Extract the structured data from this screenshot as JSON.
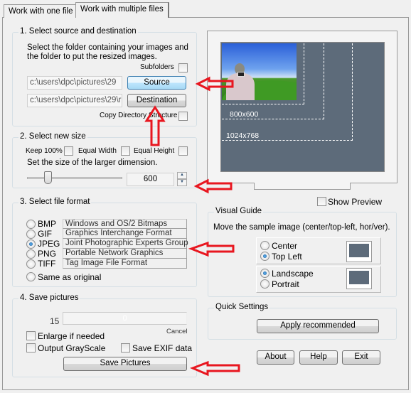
{
  "tabs": [
    {
      "label": "Work with one file"
    },
    {
      "label": "Work with multiple files",
      "active": true
    }
  ],
  "group1": {
    "title": "1. Select source and destination",
    "description_line1": "Select the folder containing your images and",
    "description_line2": "the folder to put the resized images.",
    "subfolders_label": "Subfolders",
    "subfolders_checked": false,
    "source_path": "c:\\users\\dpc\\pictures\\29",
    "destination_path": "c:\\users\\dpc\\pictures\\29\\r",
    "source_button": "Source",
    "destination_button": "Destination",
    "copy_structure_label": "Copy Directory Structure",
    "copy_structure_checked": false
  },
  "group2": {
    "title": "2. Select new size",
    "keep100_label": "Keep 100%",
    "equal_width_label": "Equal Width",
    "equal_height_label": "Equal Height",
    "instruction": "Set the size of the larger dimension.",
    "size_value": "600"
  },
  "group3": {
    "title": "3. Select file format",
    "formats": [
      {
        "name": "BMP",
        "description": "Windows and OS/2 Bitmaps",
        "selected": false
      },
      {
        "name": "GIF",
        "description": "Graphics Interchange Format",
        "selected": false
      },
      {
        "name": "JPEG",
        "description": "Joint Photographic Experts Group",
        "selected": true
      },
      {
        "name": "PNG",
        "description": "Portable Network Graphics",
        "selected": false
      },
      {
        "name": "TIFF",
        "description": "Tag Image File Format",
        "selected": false
      }
    ],
    "same_as_original_label": "Same as original"
  },
  "group4": {
    "title": "4. Save pictures",
    "count": "15",
    "progress_value": "0",
    "cancel_label": "Cancel",
    "enlarge_label": "Enlarge if needed",
    "grayscale_label": "Output GrayScale",
    "exif_label": "Save EXIF data",
    "save_button": "Save Pictures"
  },
  "preview": {
    "size_labels": [
      "800x600",
      "1024x768"
    ],
    "screen_color": "#5d6b7a",
    "show_preview_label": "Show Preview"
  },
  "visual_guide": {
    "title": "Visual Guide",
    "instruction": "Move the sample image (center/top-left, hor/ver).",
    "center_label": "Center",
    "top_left_label": "Top Left",
    "landscape_label": "Landscape",
    "portrait_label": "Portrait"
  },
  "quick_settings": {
    "title": "Quick Settings",
    "apply_button": "Apply recommended"
  },
  "footer": {
    "about": "About",
    "help": "Help",
    "exit": "Exit"
  },
  "colors": {
    "annotation_arrow": "#e8161f",
    "selected_button": "#bee6fd"
  }
}
